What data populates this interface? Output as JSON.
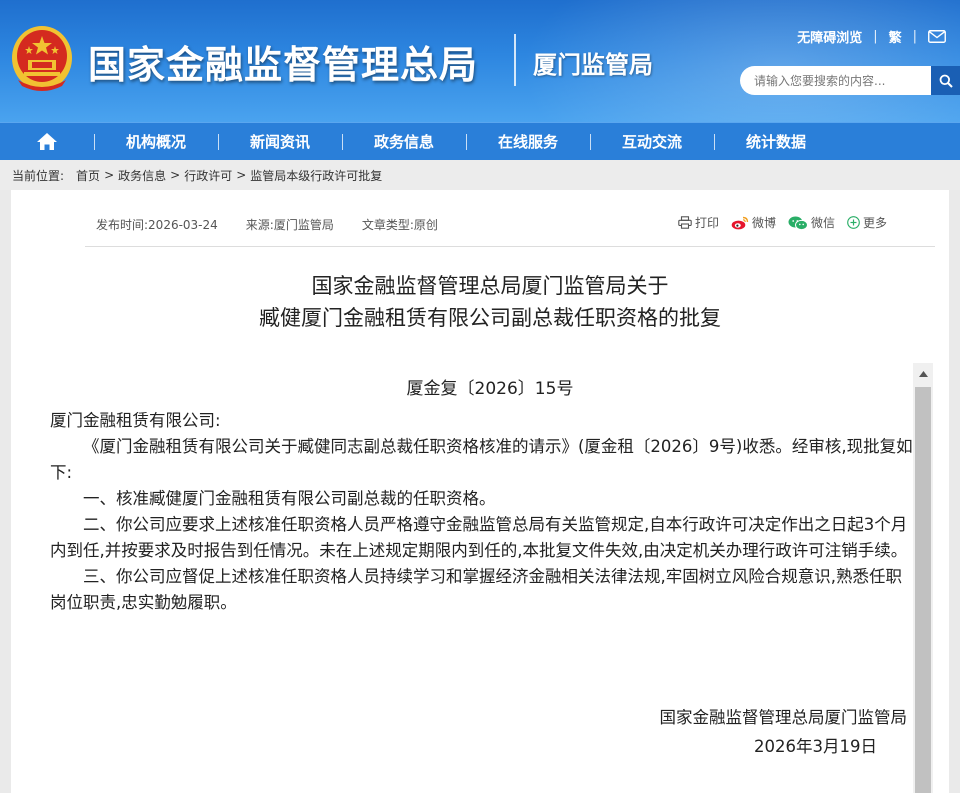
{
  "header": {
    "agency_name": "国家金融监督管理总局",
    "bureau_name": "厦门监管局",
    "top_links": {
      "accessibility": "无障碍浏览",
      "traditional": "繁"
    },
    "search": {
      "placeholder": "请输入您要搜索的内容..."
    }
  },
  "nav": {
    "items": [
      {
        "label": "机构概况"
      },
      {
        "label": "新闻资讯"
      },
      {
        "label": "政务信息"
      },
      {
        "label": "在线服务"
      },
      {
        "label": "互动交流"
      },
      {
        "label": "统计数据"
      }
    ]
  },
  "breadcrumb": {
    "prefix": "当前位置:",
    "items": [
      "首页",
      "政务信息",
      "行政许可",
      "监管局本级行政许可批复"
    ],
    "separator": ">"
  },
  "meta": {
    "publish_time": "发布时间:2026-03-24",
    "source": "来源:厦门监管局",
    "article_type": "文章类型:原创"
  },
  "tools": {
    "print": "打印",
    "weibo": "微博",
    "wechat": "微信",
    "more": "更多"
  },
  "document": {
    "title_line1": "国家金融监督管理总局厦门监管局关于",
    "title_line2": "臧健厦门金融租赁有限公司副总裁任职资格的批复",
    "number": "厦金复〔2026〕15号",
    "addressee": "厦门金融租赁有限公司:",
    "paragraphs": [
      "《厦门金融租赁有限公司关于臧健同志副总裁任职资格核准的请示》(厦金租〔2026〕9号)收悉。经审核,现批复如下:",
      "一、核准臧健厦门金融租赁有限公司副总裁的任职资格。",
      "二、你公司应要求上述核准任职资格人员严格遵守金融监管总局有关监管规定,自本行政许可决定作出之日起3个月内到任,并按要求及时报告到任情况。未在上述规定期限内到任的,本批复文件失效,由决定机关办理行政许可注销手续。",
      "三、你公司应督促上述核准任职资格人员持续学习和掌握经济金融相关法律法规,牢固树立风险合规意识,熟悉任职岗位职责,忠实勤勉履职。"
    ],
    "signature": "国家金融监督管理总局厦门监管局",
    "date": "2026年3月19日"
  },
  "colors": {
    "header_blue": "#2d86e0",
    "nav_blue": "#2a7fd9",
    "search_button": "#1a5fb4",
    "emblem_red": "#d42a1f",
    "emblem_gold": "#f1c232"
  }
}
